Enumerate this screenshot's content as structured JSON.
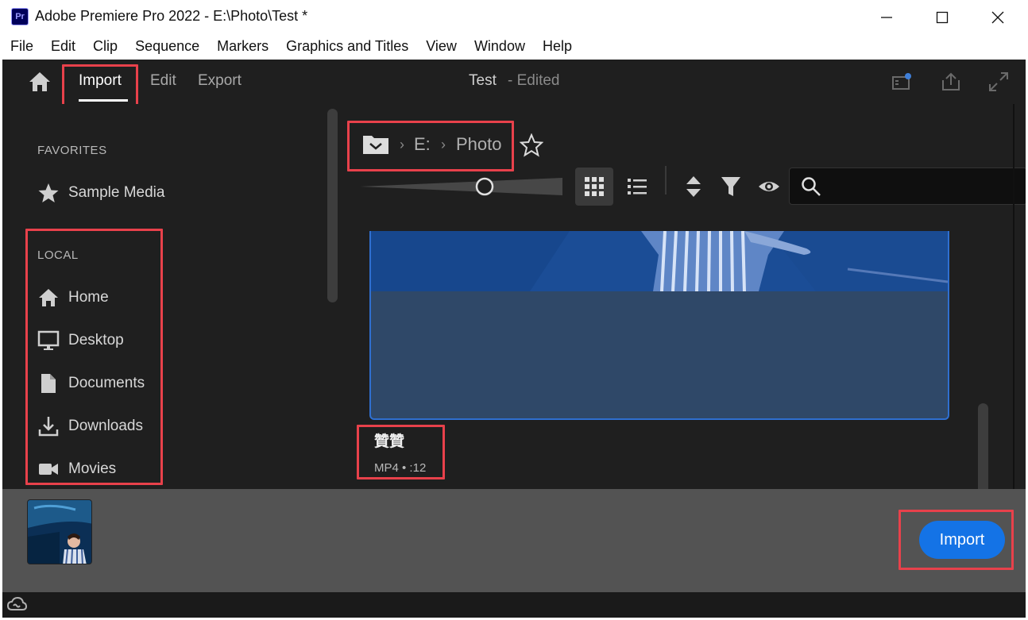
{
  "window": {
    "app_badge": "Pr",
    "title": "Adobe Premiere Pro 2022 - E:\\Photo\\Test *",
    "controls": [
      "minimize-icon",
      "maximize-icon",
      "close-icon"
    ]
  },
  "menubar": {
    "items": [
      "File",
      "Edit",
      "Clip",
      "Sequence",
      "Markers",
      "Graphics and Titles",
      "View",
      "Window",
      "Help"
    ]
  },
  "header": {
    "tabs": [
      {
        "label": "Import",
        "active": true
      },
      {
        "label": "Edit",
        "active": false
      },
      {
        "label": "Export",
        "active": false
      }
    ],
    "project_name": "Test",
    "project_status": "- Edited",
    "icons": [
      "home-icon",
      "quick-export-icon",
      "share-icon",
      "fullscreen-icon"
    ]
  },
  "sidebar": {
    "favorites_heading": "FAVORITES",
    "favorites": [
      {
        "label": "Sample Media",
        "icon": "star-icon"
      }
    ],
    "local_heading": "LOCAL",
    "local": [
      {
        "label": "Home",
        "icon": "home-icon"
      },
      {
        "label": "Desktop",
        "icon": "monitor-icon"
      },
      {
        "label": "Documents",
        "icon": "document-icon"
      },
      {
        "label": "Downloads",
        "icon": "download-icon"
      },
      {
        "label": "Movies",
        "icon": "video-camera-icon"
      }
    ]
  },
  "browser": {
    "breadcrumb": [
      "E:",
      "Photo"
    ],
    "search": {
      "value": "",
      "placeholder": ""
    },
    "view_mode": "grid",
    "media": [
      {
        "title": "贊贊",
        "meta": "MP4 • :12",
        "selected": true
      }
    ]
  },
  "tray": {
    "selected_count": 1,
    "import_label": "Import"
  },
  "colors": {
    "accent": "#1473e6",
    "highlight_box": "#e8414b",
    "panel_bg": "#1f1f1f",
    "tray_bg": "#535353",
    "selection": "#2f6fd0"
  }
}
